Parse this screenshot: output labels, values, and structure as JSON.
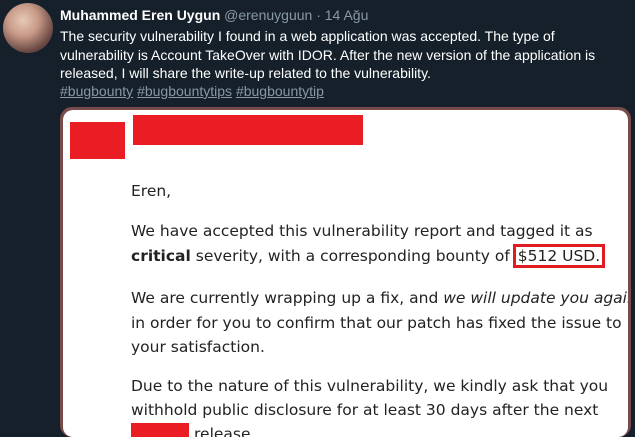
{
  "tweet": {
    "author_name": "Muhammed Eren Uygun",
    "handle": "@erenuyguun",
    "separator": "·",
    "date": "14 Ağu",
    "text": "The security vulnerability I found in a web application was accepted. The type of vulnerability is Account TakeOver with IDOR. After the new version of the application is released, I will share the write-up related to the vulnerability.",
    "hashtags": [
      "#bugbounty",
      "#bugbountytips",
      "#bugbountytip"
    ]
  },
  "email": {
    "greeting": "Eren,",
    "p1": {
      "line1": "We have accepted this vulnerability report and tagged it as",
      "line2_bold": "critical",
      "line2_rest": " severity, with a corresponding bounty of ",
      "bounty": "$512 USD."
    },
    "p2": {
      "line1_start": "We are currently wrapping up a fix, and ",
      "line1_italic": "we will update you again",
      "line2": "in order for you to confirm that our patch has fixed the issue to",
      "line3": "your satisfaction."
    },
    "p3": {
      "line1": "Due to the nature of this vulnerability, we kindly ask that you",
      "line2": "withhold public disclosure for at least 30 days after the next",
      "line3_end": "release."
    }
  },
  "colors": {
    "background": "#15202b",
    "muted": "#8899a6",
    "redaction": "#ea1c24",
    "highlight_box": "#e01b22"
  }
}
